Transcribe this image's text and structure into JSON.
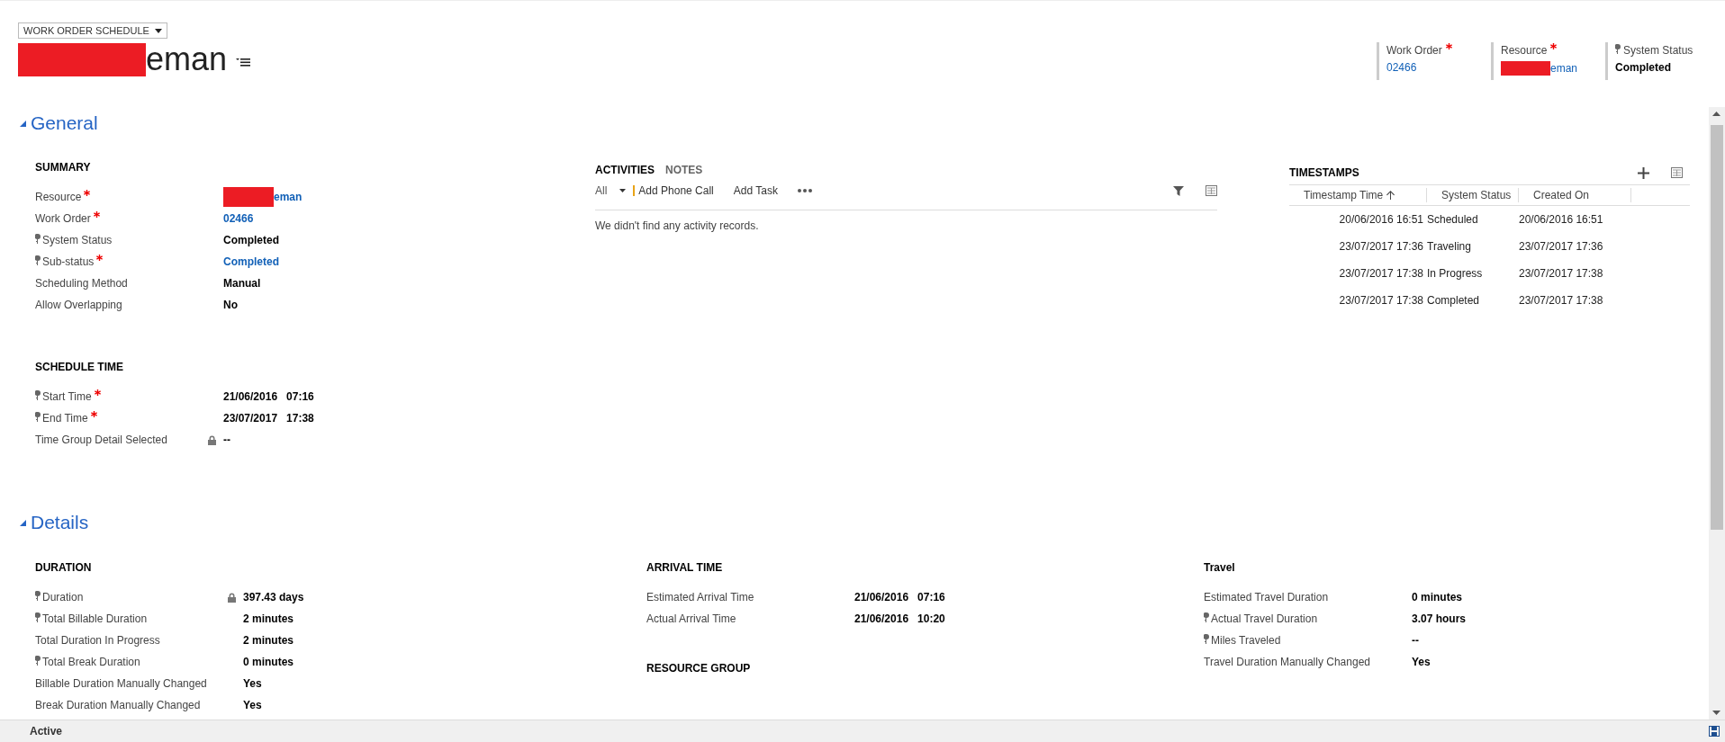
{
  "header": {
    "form_selector": "WORK ORDER SCHEDULE",
    "title": "eman",
    "title_redacted": true,
    "fields": [
      {
        "label": "Work Order",
        "required": true,
        "secured": false,
        "value": "02466",
        "link": true,
        "redacted": false
      },
      {
        "label": "Resource",
        "required": true,
        "secured": false,
        "value": "eman",
        "link": true,
        "redacted": true
      },
      {
        "label": "System Status",
        "required": false,
        "secured": true,
        "value": "Completed",
        "link": false,
        "redacted": false
      }
    ]
  },
  "general": {
    "title": "General",
    "expanded": true,
    "summary": {
      "title": "SUMMARY",
      "fields": [
        {
          "label": "Resource",
          "required": true,
          "secured": false,
          "locked": false,
          "value": "eman",
          "link": true,
          "redacted": true
        },
        {
          "label": "Work Order",
          "required": true,
          "secured": false,
          "locked": false,
          "value": "02466",
          "link": true,
          "redacted": false
        },
        {
          "label": "System Status",
          "required": false,
          "secured": true,
          "locked": false,
          "value": "Completed",
          "link": false,
          "redacted": false
        },
        {
          "label": "Sub-status",
          "required": true,
          "secured": true,
          "locked": false,
          "value": "Completed",
          "link": true,
          "redacted": false
        },
        {
          "label": "Scheduling Method",
          "required": false,
          "secured": false,
          "locked": false,
          "value": "Manual",
          "link": false,
          "redacted": false
        },
        {
          "label": "Allow Overlapping",
          "required": false,
          "secured": false,
          "locked": false,
          "value": "No",
          "link": false,
          "redacted": false
        }
      ]
    },
    "schedule_time": {
      "title": "SCHEDULE TIME",
      "fields": [
        {
          "label": "Start Time",
          "required": true,
          "secured": true,
          "locked": false,
          "value": "21/06/2016   07:16",
          "link": false,
          "redacted": false
        },
        {
          "label": "End Time",
          "required": true,
          "secured": true,
          "locked": false,
          "value": "23/07/2017   17:38",
          "link": false,
          "redacted": false
        },
        {
          "label": "Time Group Detail Selected",
          "required": false,
          "secured": false,
          "locked": true,
          "value": "--",
          "link": false,
          "redacted": false
        }
      ]
    },
    "activities": {
      "tabs": [
        {
          "label": "ACTIVITIES",
          "selected": true
        },
        {
          "label": "NOTES",
          "selected": false
        }
      ],
      "filter": "All",
      "actions": [
        "Add Phone Call",
        "Add Task"
      ],
      "empty_message": "We didn't find any activity records."
    },
    "timestamps": {
      "title": "TIMESTAMPS",
      "columns": [
        {
          "label": "Timestamp Time",
          "sorted": true
        },
        {
          "label": "System Status",
          "sorted": false
        },
        {
          "label": "Created On",
          "sorted": false
        }
      ],
      "rows": [
        [
          "20/06/2016 16:51",
          "Scheduled",
          "20/06/2016 16:51"
        ],
        [
          "23/07/2017 17:36",
          "Traveling",
          "23/07/2017 17:36"
        ],
        [
          "23/07/2017 17:38",
          "In Progress",
          "23/07/2017 17:38"
        ],
        [
          "23/07/2017 17:38",
          "Completed",
          "23/07/2017 17:38"
        ]
      ]
    }
  },
  "details": {
    "title": "Details",
    "expanded": true,
    "columns": [
      [
        {
          "title": "DURATION",
          "fields": [
            {
              "label": "Duration",
              "required": false,
              "secured": true,
              "locked": true,
              "value": "397.43 days",
              "link": false,
              "redacted": false
            },
            {
              "label": "Total Billable Duration",
              "required": false,
              "secured": true,
              "locked": false,
              "value": "2 minutes",
              "link": false,
              "redacted": false
            },
            {
              "label": "Total Duration In Progress",
              "required": false,
              "secured": false,
              "locked": false,
              "value": "2 minutes",
              "link": false,
              "redacted": false
            },
            {
              "label": "Total Break Duration",
              "required": false,
              "secured": true,
              "locked": false,
              "value": "0 minutes",
              "link": false,
              "redacted": false
            },
            {
              "label": "Billable Duration Manually Changed",
              "required": false,
              "secured": false,
              "locked": false,
              "value": "Yes",
              "link": false,
              "redacted": false
            },
            {
              "label": "Break Duration Manually Changed",
              "required": false,
              "secured": false,
              "locked": false,
              "value": "Yes",
              "link": false,
              "redacted": false
            }
          ]
        }
      ],
      [
        {
          "title": "ARRIVAL TIME",
          "fields": [
            {
              "label": "Estimated Arrival Time",
              "required": false,
              "secured": false,
              "locked": false,
              "value": "21/06/2016   07:16",
              "link": false,
              "redacted": false
            },
            {
              "label": "Actual Arrival Time",
              "required": false,
              "secured": false,
              "locked": false,
              "value": "21/06/2016   10:20",
              "link": false,
              "redacted": false
            }
          ]
        },
        {
          "title": "RESOURCE GROUP"
        }
      ],
      [
        {
          "title": "Travel",
          "fields": [
            {
              "label": "Estimated Travel Duration",
              "required": false,
              "secured": false,
              "locked": false,
              "value": "0 minutes",
              "link": false,
              "redacted": false
            },
            {
              "label": "Actual Travel Duration",
              "required": false,
              "secured": true,
              "locked": false,
              "value": "3.07 hours",
              "link": false,
              "redacted": false
            },
            {
              "label": "Miles Traveled",
              "required": false,
              "secured": true,
              "locked": false,
              "value": "--",
              "link": false,
              "redacted": false
            },
            {
              "label": "Travel Duration Manually Changed",
              "required": false,
              "secured": false,
              "locked": false,
              "value": "Yes",
              "link": false,
              "redacted": false
            }
          ]
        }
      ]
    ]
  },
  "status_bar": {
    "status": "Active"
  }
}
